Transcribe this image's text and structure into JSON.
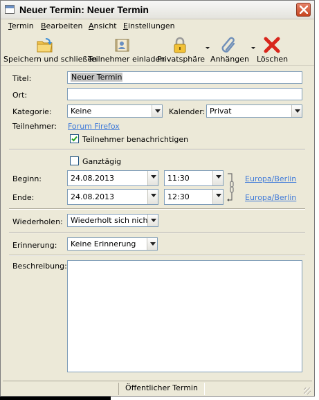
{
  "window": {
    "title": "Neuer Termin: Neuer Termin"
  },
  "menu": [
    "Termin",
    "Bearbeiten",
    "Ansicht",
    "Einstellungen"
  ],
  "toolbar": {
    "save": "Speichern und schließen",
    "invite": "Teilnehmer einladen",
    "privacy": "Privatsphäre",
    "attach": "Anhängen",
    "delete": "Löschen"
  },
  "form": {
    "title_label": "Titel:",
    "title_value": "Neuer Termin",
    "location_label": "Ort:",
    "location_value": "",
    "category_label": "Kategorie:",
    "category_value": "Keine",
    "calendar_label": "Kalender:",
    "calendar_value": "Privat",
    "attendees_label": "Teilnehmer:",
    "attendees_link": "Forum Firefox",
    "notify_label": "Teilnehmer benachrichtigen",
    "notify_checked": true,
    "allday_label": "Ganztägig",
    "allday_checked": false,
    "start_label": "Beginn:",
    "start_date": "24.08.2013",
    "start_time": "11:30",
    "start_tz": "Europa/Berlin",
    "end_label": "Ende:",
    "end_date": "24.08.2013",
    "end_time": "12:30",
    "end_tz": "Europa/Berlin",
    "repeat_label": "Wiederholen:",
    "repeat_value": "Wiederholt sich nicht",
    "reminder_label": "Erinnerung:",
    "reminder_value": "Keine Erinnerung",
    "description_label": "Beschreibung:",
    "description_value": ""
  },
  "status": {
    "privacy": "Öffentlicher Termin"
  }
}
